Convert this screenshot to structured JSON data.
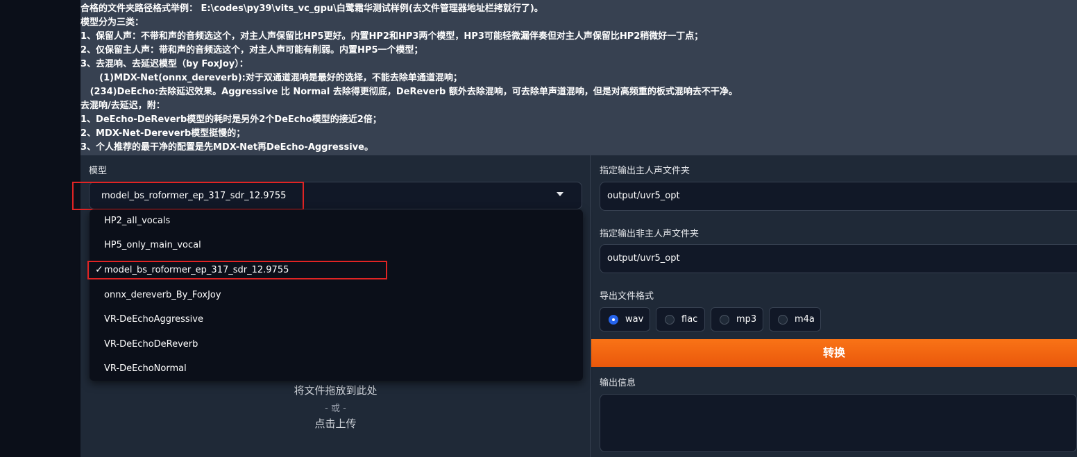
{
  "description": [
    "合格的文件夹路径格式举例： E:\\codes\\py39\\vits_vc_gpu\\白鹭霜华测试样例(去文件管理器地址栏拷就行了)。",
    "模型分为三类：",
    "1、保留人声：不带和声的音频选这个，对主人声保留比HP5更好。内置HP2和HP3两个模型，HP3可能轻微漏伴奏但对主人声保留比HP2稍微好一丁点；",
    "2、仅保留主人声：带和声的音频选这个，对主人声可能有削弱。内置HP5一个模型；",
    "3、去混响、去延迟模型（by FoxJoy）：",
    "      (1)MDX-Net(onnx_dereverb):对于双通道混响是最好的选择，不能去除单通道混响；",
    "   (234)DeEcho:去除延迟效果。Aggressive 比 Normal 去除得更彻底，DeReverb 额外去除混响，可去除单声道混响，但是对高频重的板式混响去不干净。",
    "去混响/去延迟，附：",
    "1、DeEcho-DeReverb模型的耗时是另外2个DeEcho模型的接近2倍；",
    "2、MDX-Net-Dereverb模型挺慢的；",
    "3、个人推荐的最干净的配置是先MDX-Net再DeEcho-Aggressive。"
  ],
  "model": {
    "label": "模型",
    "selected": "model_bs_roformer_ep_317_sdr_12.9755",
    "options": [
      "HP2_all_vocals",
      "HP5_only_main_vocal",
      "model_bs_roformer_ep_317_sdr_12.9755",
      "onnx_dereverb_By_FoxJoy",
      "VR-DeEchoAggressive",
      "VR-DeEchoDeReverb",
      "VR-DeEchoNormal"
    ],
    "check_mark": "✓"
  },
  "upload": {
    "drop_text": "将文件拖放到此处",
    "or_text": "- 或 -",
    "click_text": "点击上传"
  },
  "vocal_output": {
    "label": "指定输出主人声文件夹",
    "value": "output/uvr5_opt"
  },
  "ins_output": {
    "label": "指定输出非主人声文件夹",
    "value": "output/uvr5_opt"
  },
  "format": {
    "label": "导出文件格式",
    "options": [
      "wav",
      "flac",
      "mp3",
      "m4a"
    ],
    "selected": "wav"
  },
  "convert_button": "转换",
  "output_info": {
    "label": "输出信息",
    "value": ""
  },
  "colors": {
    "accent_orange": "#f97316",
    "highlight_red": "#e02424",
    "radio_selected": "#2563eb"
  }
}
